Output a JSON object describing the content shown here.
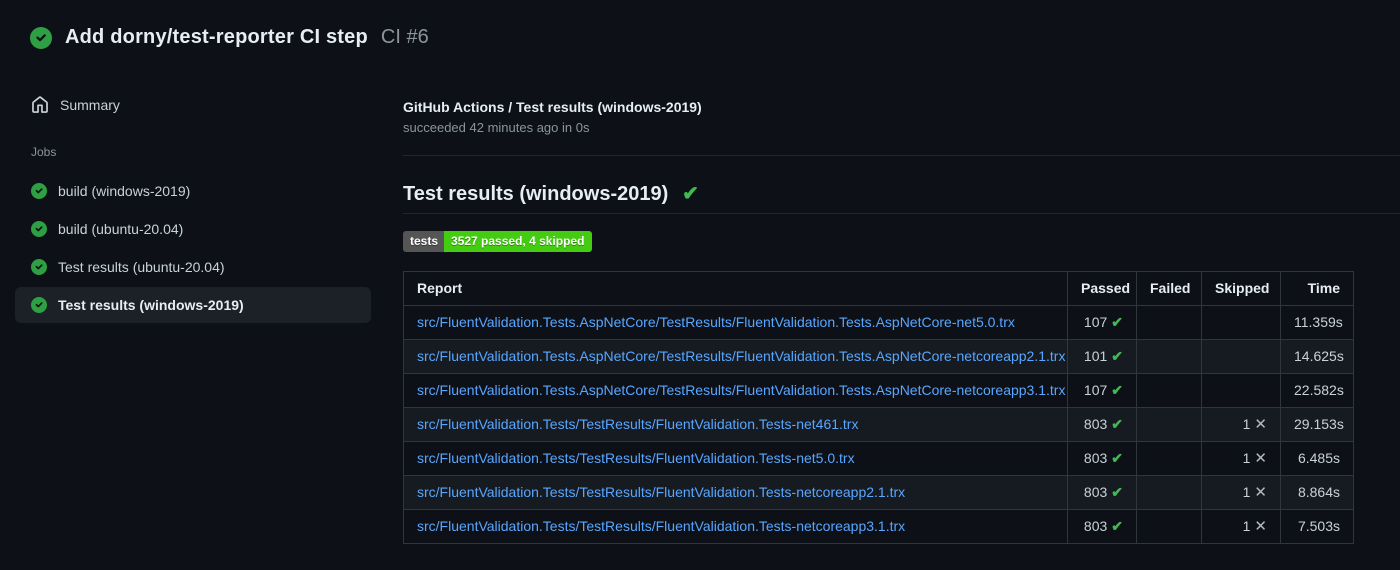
{
  "glyphs": {
    "check": "✔",
    "cross": "✕"
  },
  "colors": {
    "background": "#0d1117",
    "success_green": "#2ea043",
    "check_green": "#3fb950",
    "link_blue": "#58a6ff",
    "badge_label_bg": "#555555",
    "badge_value_bg": "#44cc11",
    "row_stripe": "#161b22",
    "table_border": "#30363d"
  },
  "header": {
    "title": "Add dorny/test-reporter CI step",
    "run_number": "CI #6"
  },
  "sidebar": {
    "summary_label": "Summary",
    "jobs_label": "Jobs",
    "jobs": [
      {
        "label": "build (windows-2019)"
      },
      {
        "label": "build (ubuntu-20.04)"
      },
      {
        "label": "Test results (ubuntu-20.04)"
      },
      {
        "label": "Test results (windows-2019)"
      }
    ]
  },
  "main": {
    "job_title": "GitHub Actions / Test results (windows-2019)",
    "job_status": "succeeded 42 minutes ago in 0s",
    "section_heading": "Test results (windows-2019)",
    "badge": {
      "label": "tests",
      "value": "3527 passed, 4 skipped"
    },
    "table": {
      "columns": [
        "Report",
        "Passed",
        "Failed",
        "Skipped",
        "Time"
      ],
      "rows": [
        {
          "report": "src/FluentValidation.Tests.AspNetCore/TestResults/FluentValidation.Tests.AspNetCore-net5.0.trx",
          "passed": "107",
          "failed": "",
          "skipped": "",
          "time": "11.359s"
        },
        {
          "report": "src/FluentValidation.Tests.AspNetCore/TestResults/FluentValidation.Tests.AspNetCore-netcoreapp2.1.trx",
          "passed": "101",
          "failed": "",
          "skipped": "",
          "time": "14.625s"
        },
        {
          "report": "src/FluentValidation.Tests.AspNetCore/TestResults/FluentValidation.Tests.AspNetCore-netcoreapp3.1.trx",
          "passed": "107",
          "failed": "",
          "skipped": "",
          "time": "22.582s"
        },
        {
          "report": "src/FluentValidation.Tests/TestResults/FluentValidation.Tests-net461.trx",
          "passed": "803",
          "failed": "",
          "skipped": "1",
          "time": "29.153s"
        },
        {
          "report": "src/FluentValidation.Tests/TestResults/FluentValidation.Tests-net5.0.trx",
          "passed": "803",
          "failed": "",
          "skipped": "1",
          "time": "6.485s"
        },
        {
          "report": "src/FluentValidation.Tests/TestResults/FluentValidation.Tests-netcoreapp2.1.trx",
          "passed": "803",
          "failed": "",
          "skipped": "1",
          "time": "8.864s"
        },
        {
          "report": "src/FluentValidation.Tests/TestResults/FluentValidation.Tests-netcoreapp3.1.trx",
          "passed": "803",
          "failed": "",
          "skipped": "1",
          "time": "7.503s"
        }
      ]
    }
  }
}
